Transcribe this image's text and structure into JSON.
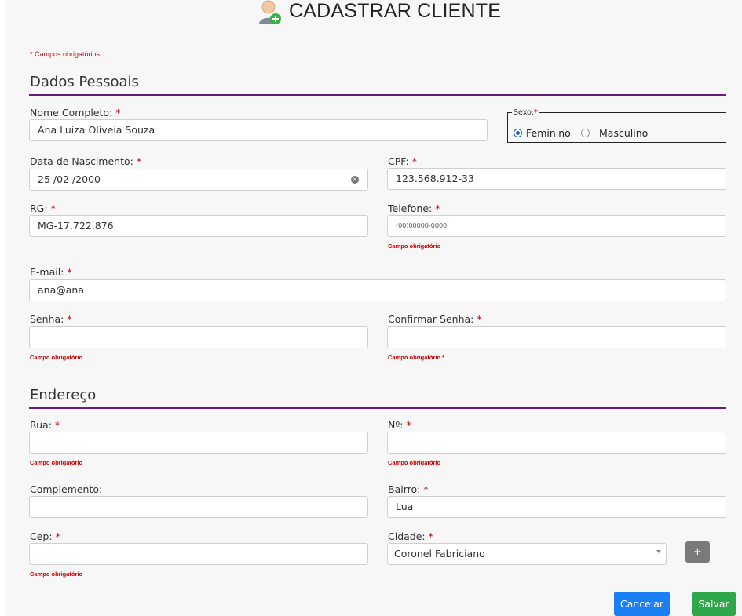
{
  "header": {
    "title": "CADASTRAR CLIENTE",
    "icon": "user-add-icon"
  },
  "required_note": "* Campos obrigatórios",
  "sections": {
    "personal": "Dados Pessoais",
    "address": "Endereço"
  },
  "required_marker": "*",
  "fields": {
    "nome": {
      "label": "Nome Completo:",
      "value": "Ana Luiza Oliveia Souza"
    },
    "sexo": {
      "legend": "Sexo:",
      "options": [
        "Feminino",
        "Masculino"
      ],
      "selected": "Feminino"
    },
    "nascimento": {
      "label": "Data de Nascimento:",
      "value": "25 /02 /2000"
    },
    "cpf": {
      "label": "CPF:",
      "value": "123.568.912-33"
    },
    "rg": {
      "label": "RG:",
      "value": "MG-17.722.876"
    },
    "telefone": {
      "label": "Telefone:",
      "placeholder": "(00)00000-0000",
      "error": "Campo obrigatório"
    },
    "email": {
      "label": "E-mail:",
      "value": "ana@ana"
    },
    "senha": {
      "label": "Senha:",
      "value": "",
      "error": "Campo obrigatório"
    },
    "confirmar_senha": {
      "label": "Confirmar Senha:",
      "value": "",
      "error": "Campo obrigatório.*"
    },
    "rua": {
      "label": "Rua:",
      "value": "",
      "error": "Campo obrigatório"
    },
    "numero": {
      "label": "Nº:",
      "value": "",
      "error": "Campo obrigatório"
    },
    "complemento": {
      "label": "Complemento:",
      "value": ""
    },
    "bairro": {
      "label": "Bairro:",
      "value": "Lua"
    },
    "cep": {
      "label": "Cep:",
      "value": "",
      "error": "Campo obrigatório"
    },
    "cidade": {
      "label": "Cidade:",
      "value": "Coronel Fabriciano"
    }
  },
  "buttons": {
    "add": "+",
    "cancel": "Cancelar",
    "save": "Salvar"
  },
  "colors": {
    "accent_rule": "#6a1b7a",
    "required": "#cc0000",
    "cancel": "#1a7ff2",
    "save": "#2ea84a"
  }
}
